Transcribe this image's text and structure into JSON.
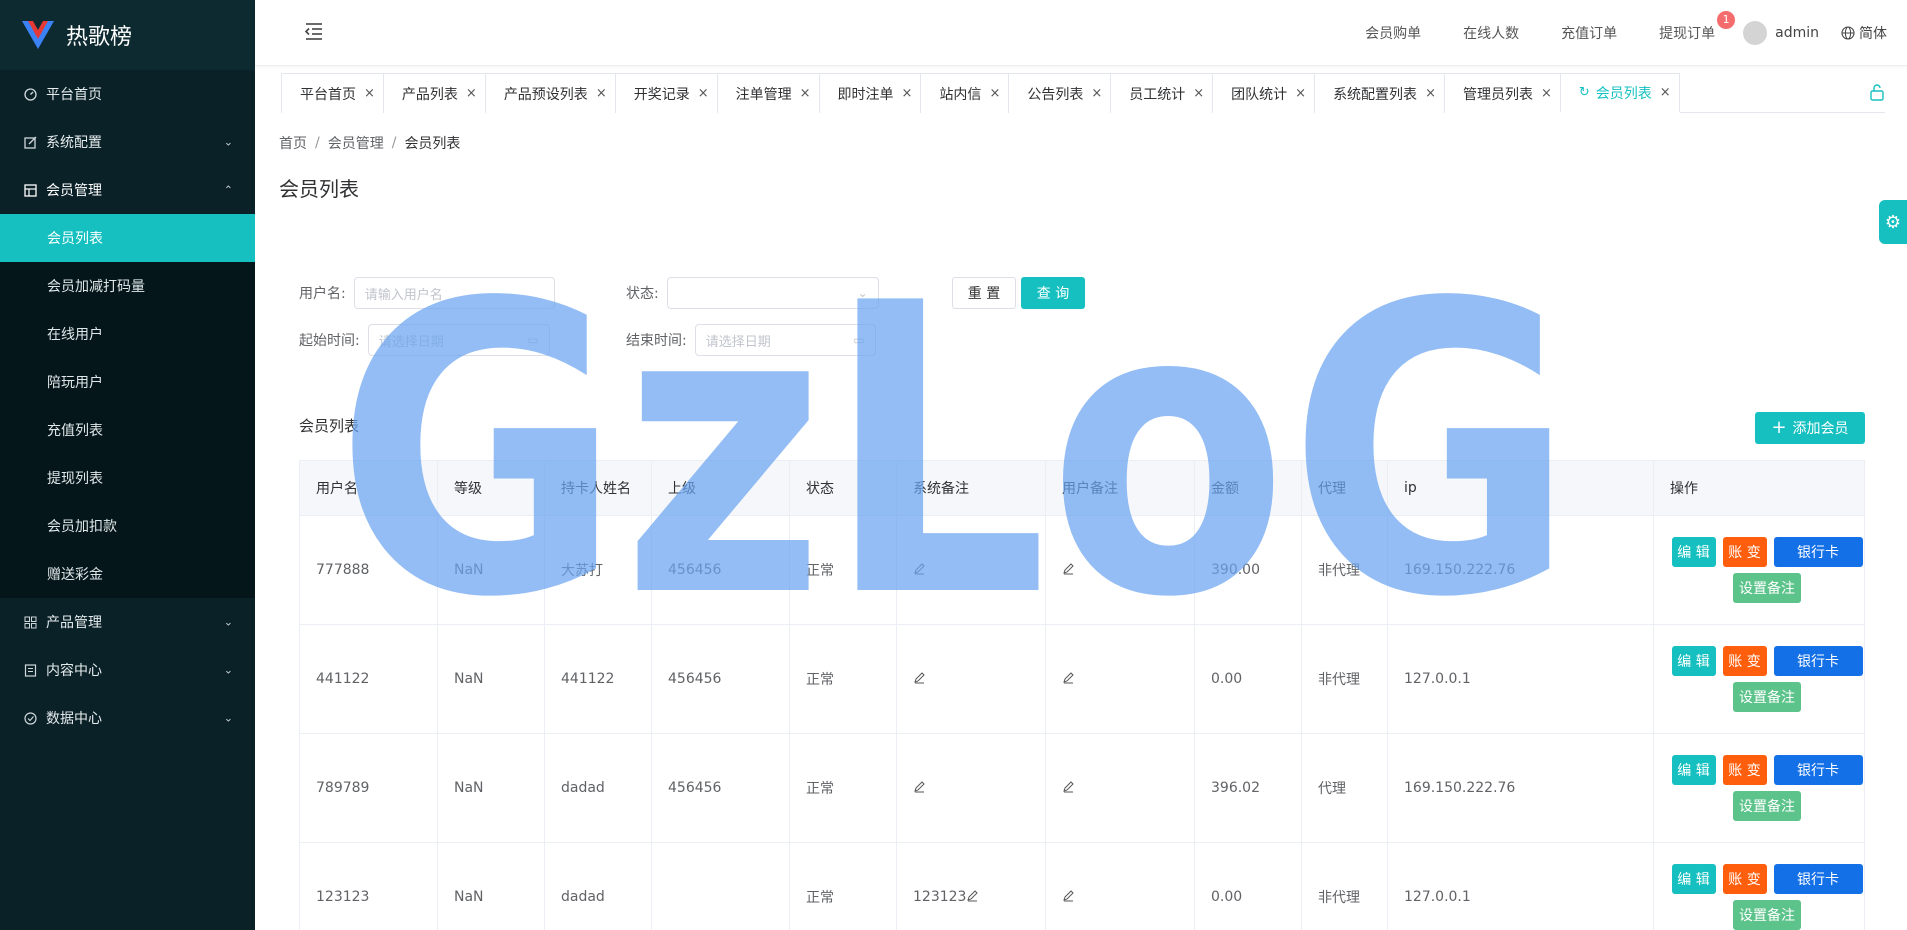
{
  "app": {
    "title": "热歌榜"
  },
  "sidebar": {
    "items": [
      {
        "label": "平台首页",
        "icon": "dashboard-icon"
      },
      {
        "label": "系统配置",
        "icon": "edit-icon",
        "expandable": true
      },
      {
        "label": "会员管理",
        "icon": "grid-icon",
        "expandable": true,
        "open": true,
        "children": [
          "会员列表",
          "会员加减打码量",
          "在线用户",
          "陪玩用户",
          "充值列表",
          "提现列表",
          "会员加扣款",
          "赠送彩金"
        ],
        "active_child": "会员列表"
      },
      {
        "label": "产品管理",
        "icon": "apps-icon",
        "expandable": true
      },
      {
        "label": "内容中心",
        "icon": "document-icon",
        "expandable": true
      },
      {
        "label": "数据中心",
        "icon": "check-circle-icon",
        "expandable": true
      }
    ]
  },
  "header": {
    "links": [
      "会员购单",
      "在线人数",
      "充值订单",
      "提现订单"
    ],
    "withdraw_badge": "1",
    "user": "admin",
    "language": "简体"
  },
  "tabs": [
    "平台首页",
    "产品列表",
    "产品预设列表",
    "开奖记录",
    "注单管理",
    "即时注单",
    "站内信",
    "公告列表",
    "员工统计",
    "团队统计",
    "系统配置列表",
    "管理员列表",
    "会员列表"
  ],
  "active_tab": "会员列表",
  "breadcrumb": [
    "首页",
    "会员管理",
    "会员列表"
  ],
  "page_title": "会员列表",
  "filters": {
    "username_label": "用户名:",
    "username_placeholder": "请输入用户名",
    "status_label": "状态:",
    "start_label": "起始时间:",
    "start_placeholder": "请选择日期",
    "end_label": "结束时间:",
    "end_placeholder": "请选择日期",
    "reset": "重 置",
    "query": "查 询"
  },
  "table": {
    "title": "会员列表",
    "add_button": "添加会员",
    "columns": [
      "用户名",
      "等级",
      "持卡人姓名",
      "上级",
      "状态",
      "系统备注",
      "用户备注",
      "金额",
      "代理",
      "ip",
      "操作"
    ],
    "rows": [
      {
        "username": "777888",
        "level": "NaN",
        "holder": "大苏打",
        "parent": "456456",
        "status": "正常",
        "sys_note": "",
        "user_note": "",
        "amount": "390.00",
        "agent": "非代理",
        "ip": "169.150.222.76"
      },
      {
        "username": "441122",
        "level": "NaN",
        "holder": "441122",
        "parent": "456456",
        "status": "正常",
        "sys_note": "",
        "user_note": "",
        "amount": "0.00",
        "agent": "非代理",
        "ip": "127.0.0.1"
      },
      {
        "username": "789789",
        "level": "NaN",
        "holder": "dadad",
        "parent": "456456",
        "status": "正常",
        "sys_note": "",
        "user_note": "",
        "amount": "396.02",
        "agent": "代理",
        "ip": "169.150.222.76"
      },
      {
        "username": "123123",
        "level": "NaN",
        "holder": "dadad",
        "parent": "",
        "status": "正常",
        "sys_note": "123123",
        "user_note": "",
        "amount": "0.00",
        "agent": "非代理",
        "ip": "127.0.0.1"
      }
    ],
    "actions": {
      "edit": "编 辑",
      "account": "账 变",
      "bank": "银行卡",
      "note": "设置备注"
    }
  },
  "watermark": "GzLoG",
  "colors": {
    "accent": "#16c0c0",
    "sidebar_bg": "#0a2127",
    "danger": "#ff5f0d",
    "primary": "#1470e6",
    "success": "#5cc38b",
    "watermark": "#6aa3f0"
  }
}
